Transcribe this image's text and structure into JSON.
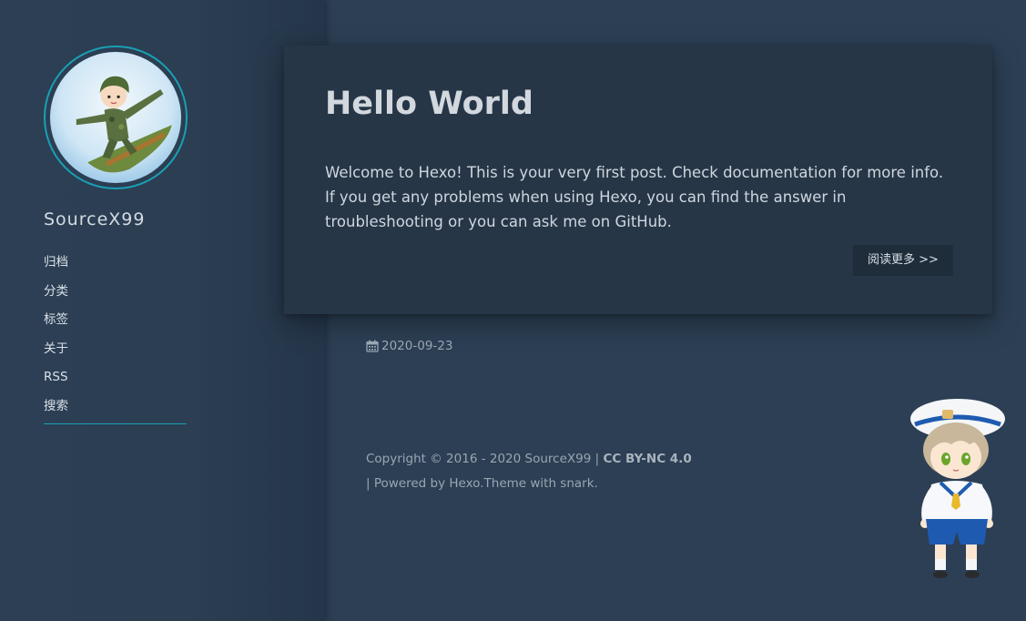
{
  "sidebar": {
    "site_name": "SourceX99",
    "avatar_icon": "soldier-avatar-icon",
    "nav": [
      {
        "label": "归档"
      },
      {
        "label": "分类"
      },
      {
        "label": "标签"
      },
      {
        "label": "关于"
      },
      {
        "label": "RSS"
      },
      {
        "label": "搜索"
      }
    ],
    "active_index": 5
  },
  "post": {
    "title": "Hello World",
    "excerpt": "Welcome to Hexo! This is your very first post. Check documentation for more info. If you get any problems when using Hexo, you can find the answer in troubleshooting or you can ask me on GitHub.",
    "read_more_label": "阅读更多 >>",
    "date": "2020-09-23",
    "date_icon": "calendar-icon"
  },
  "footer": {
    "copyright": "Copyright © 2016 - 2020 SourceX99 |",
    "license": "CC BY-NC 4.0",
    "powered_prefix": "| Powered by",
    "powered_link": "Hexo",
    "theme_text": ".Theme with snark."
  },
  "mascot_icon": "sailor-mascot-icon",
  "colors": {
    "background": "#2c3f54",
    "card": "#263647",
    "accent": "#1a9fb5"
  }
}
